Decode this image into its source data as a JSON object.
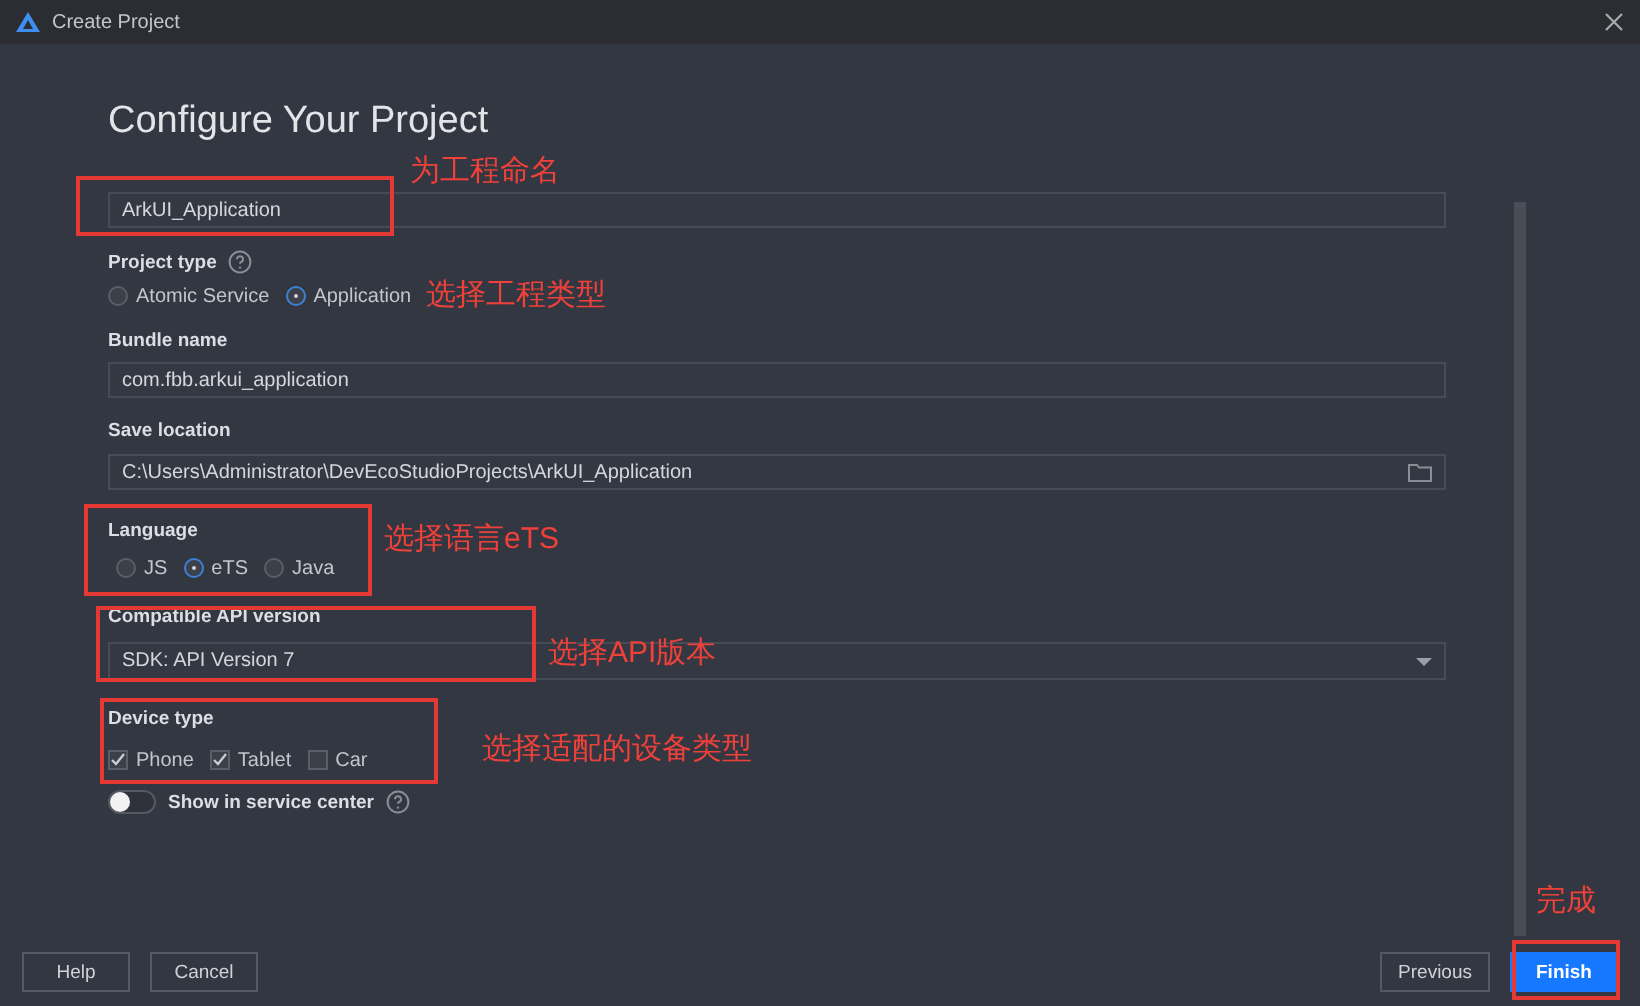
{
  "window": {
    "title": "Create Project"
  },
  "heading": "Configure Your Project",
  "project_name": {
    "value": "ArkUI_Application"
  },
  "project_type": {
    "label": "Project type",
    "options": [
      {
        "label": "Atomic Service",
        "selected": false
      },
      {
        "label": "Application",
        "selected": true
      }
    ]
  },
  "bundle_name": {
    "label": "Bundle name",
    "value": "com.fbb.arkui_application"
  },
  "save_location": {
    "label": "Save location",
    "value": "C:\\Users\\Administrator\\DevEcoStudioProjects\\ArkUI_Application"
  },
  "language": {
    "label": "Language",
    "options": [
      {
        "label": "JS",
        "selected": false
      },
      {
        "label": "eTS",
        "selected": true
      },
      {
        "label": "Java",
        "selected": false
      }
    ]
  },
  "api_version": {
    "label": "Compatible API version",
    "value": "SDK: API Version 7"
  },
  "device_type": {
    "label": "Device type",
    "options": [
      {
        "label": "Phone",
        "checked": true
      },
      {
        "label": "Tablet",
        "checked": true
      },
      {
        "label": "Car",
        "checked": false
      }
    ]
  },
  "service_center": {
    "label": "Show in service center",
    "on": false
  },
  "buttons": [
    {
      "label": "Help",
      "primary": false
    },
    {
      "label": "Cancel",
      "primary": false
    },
    {
      "label": "Previous",
      "primary": false
    },
    {
      "label": "Finish",
      "primary": true
    }
  ],
  "annotations": [
    {
      "text": "为工程命名"
    },
    {
      "text": "选择工程类型"
    },
    {
      "text": "选择语言eTS"
    },
    {
      "text": "选择API版本"
    },
    {
      "text": "选择适配的设备类型"
    },
    {
      "text": "完成"
    }
  ]
}
